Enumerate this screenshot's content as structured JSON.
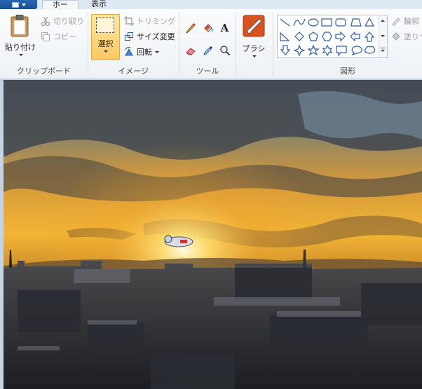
{
  "tabs": {
    "home": "ホーム",
    "view": "表示"
  },
  "clipboard": {
    "paste_label": "貼り付け",
    "cut_label": "切り取り",
    "copy_label": "コピー",
    "group_label": "クリップボード"
  },
  "image": {
    "select_label": "選択",
    "crop_label": "トリミング",
    "resize_label": "サイズ変更",
    "rotate_label": "回転",
    "group_label": "イメージ"
  },
  "tools": {
    "group_label": "ツール",
    "items": [
      "pencil-icon",
      "fill-bucket-icon",
      "text-icon",
      "eraser-icon",
      "color-picker-icon",
      "magnifier-icon"
    ]
  },
  "brush": {
    "label": "ブラシ"
  },
  "shapes": {
    "group_label": "図形",
    "outline_label": "輪郭",
    "fill_label": "塗りつ"
  },
  "colors": {
    "accent": "#1b4f96",
    "selected_tool": "#fcd777",
    "ribbon_bg": "#f5f6f7"
  }
}
